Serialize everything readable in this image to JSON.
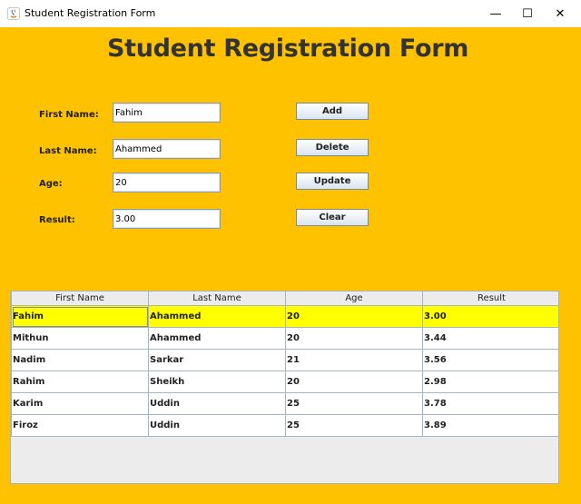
{
  "window": {
    "title": "Student Registration Form",
    "controls": [
      "—",
      "☐",
      "✕"
    ]
  },
  "form": {
    "heading": "Student Registration Form",
    "fields": [
      {
        "label": "First Name:",
        "value": "Fahim"
      },
      {
        "label": "Last Name:",
        "value": "Ahammed"
      },
      {
        "label": "Age:",
        "value": "20"
      },
      {
        "label": "Result:",
        "value": "3.00"
      }
    ],
    "buttons": [
      "Add",
      "Delete",
      "Update",
      "Clear"
    ]
  },
  "table": {
    "columns": [
      "First Name",
      "Last Name",
      "Age",
      "Result"
    ],
    "rows": [
      [
        "Fahim",
        "Ahammed",
        "20",
        "3.00"
      ],
      [
        "Mithun",
        "Ahammed",
        "20",
        "3.44"
      ],
      [
        "Nadim",
        "Sarkar",
        "21",
        "3.56"
      ],
      [
        "Rahim",
        "Sheikh",
        "20",
        "2.98"
      ],
      [
        "Karim",
        "Uddin",
        "25",
        "3.78"
      ],
      [
        "Firoz",
        "Uddin",
        "25",
        "3.89"
      ]
    ],
    "selected_row": 0
  },
  "colors": {
    "background": "#ffc200",
    "selected_row": "#ffff00",
    "heading_text": "#333333"
  }
}
